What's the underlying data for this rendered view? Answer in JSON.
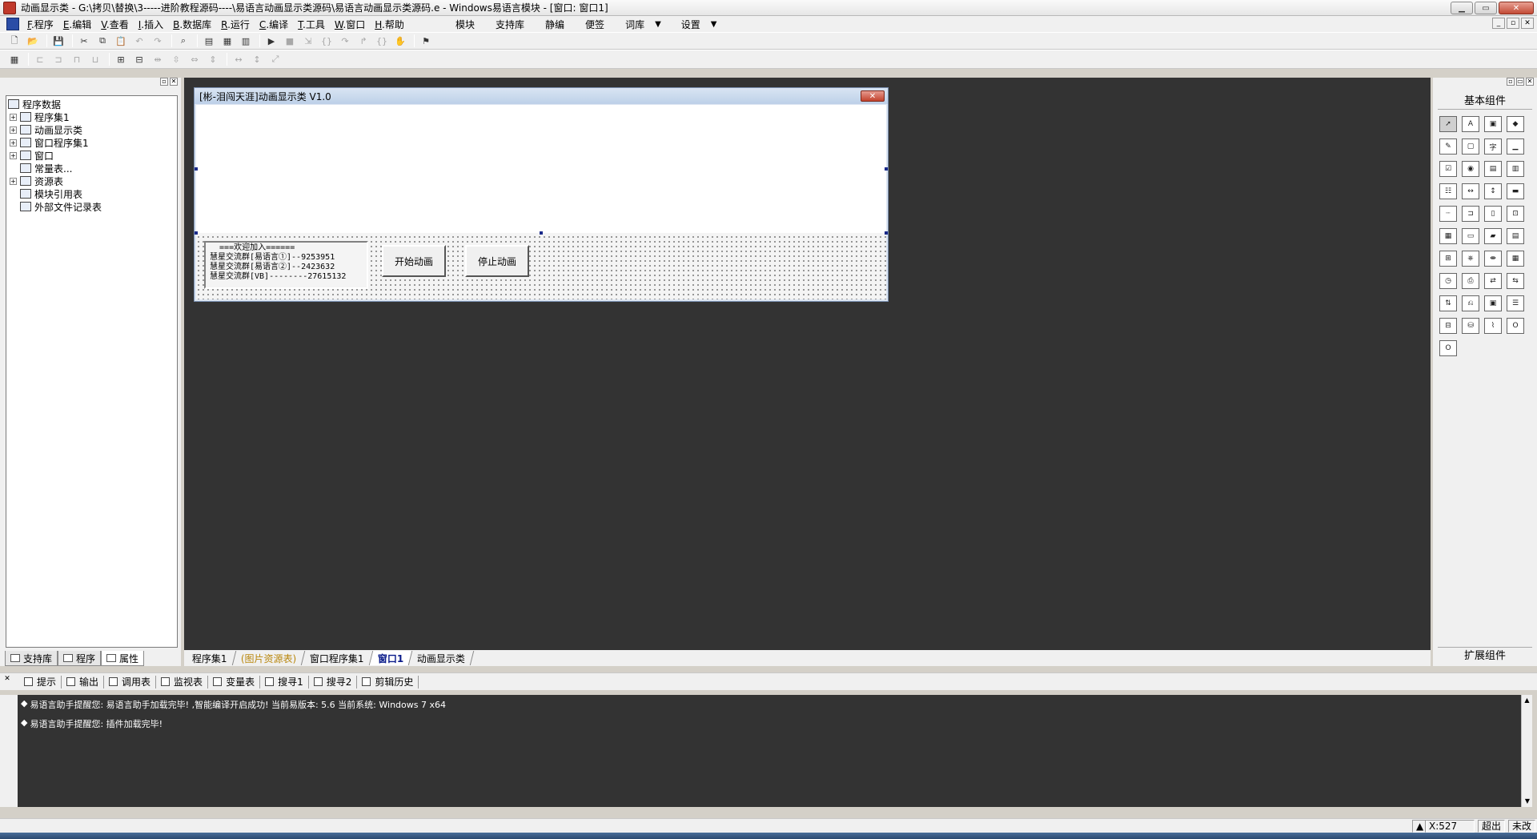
{
  "window": {
    "title": "动画显示类 - G:\\拷贝\\替换\\3-----进阶教程源码----\\易语言动画显示类源码\\易语言动画显示类源码.e - Windows易语言模块 - [窗口: 窗口1]",
    "min": "▁",
    "max": "▭",
    "close": "✕"
  },
  "menu": {
    "items": [
      {
        "key": "F",
        "label": ".程序"
      },
      {
        "key": "E",
        "label": ".编辑"
      },
      {
        "key": "V",
        "label": ".查看"
      },
      {
        "key": "I",
        "label": ".插入"
      },
      {
        "key": "B",
        "label": ".数据库"
      },
      {
        "key": "R",
        "label": ".运行"
      },
      {
        "key": "C",
        "label": ".编译"
      },
      {
        "key": "T",
        "label": ".工具"
      },
      {
        "key": "W",
        "label": ".窗口"
      },
      {
        "key": "H",
        "label": ".帮助"
      }
    ],
    "right_items": [
      "模块",
      "支持库",
      "静编",
      "便签",
      "词库",
      "设置"
    ],
    "dropdown_glyph": "▼"
  },
  "left_panel": {
    "tree": [
      {
        "label": "程序数据",
        "indent": 0,
        "expander": ""
      },
      {
        "label": "程序集1",
        "indent": 1,
        "expander": "+"
      },
      {
        "label": "动画显示类",
        "indent": 1,
        "expander": "+"
      },
      {
        "label": "窗口程序集1",
        "indent": 1,
        "expander": "+"
      },
      {
        "label": "窗口",
        "indent": 1,
        "expander": "+"
      },
      {
        "label": "常量表...",
        "indent": 1,
        "expander": ""
      },
      {
        "label": "资源表",
        "indent": 1,
        "expander": "+"
      },
      {
        "label": "模块引用表",
        "indent": 1,
        "expander": ""
      },
      {
        "label": "外部文件记录表",
        "indent": 1,
        "expander": ""
      }
    ],
    "tabs": [
      "支持库",
      "程序",
      "属性"
    ]
  },
  "design_window": {
    "title": "[彬-泪闯天涯]动画显示类 V1.0",
    "close_glyph": "✕",
    "info_lines": [
      "  ===欢迎加入======",
      "慧星交流群[易语言①]--9253951",
      "慧星交流群[易语言②]--2423632",
      "慧星交流群[VB]--------27615132"
    ],
    "start_button": "开始动画",
    "stop_button": "停止动画"
  },
  "workspace_tabs": [
    {
      "label": "程序集1",
      "style": ""
    },
    {
      "label": "(图片资源表)",
      "style": "gold"
    },
    {
      "label": "窗口程序集1",
      "style": ""
    },
    {
      "label": "窗口1",
      "style": "active"
    },
    {
      "label": "动画显示类",
      "style": ""
    }
  ],
  "right_panel": {
    "title": "基本组件",
    "footer": "扩展组件"
  },
  "output_tabs": [
    "提示",
    "输出",
    "调用表",
    "监视表",
    "变量表",
    "搜寻1",
    "搜寻2",
    "剪辑历史"
  ],
  "output_lines": [
    "易语言助手提醒您: 易语言助手加载完毕! ,智能编译开启成功! 当前易版本: 5.6 当前系统: Windows 7 x64",
    "易语言助手提醒您: 插件加载完毕!"
  ],
  "status": {
    "position": "X:527",
    "overflow": "超出",
    "modified": "未改"
  },
  "colors": {
    "workspace_bg": "#333333",
    "close_red": "#c24a35"
  }
}
